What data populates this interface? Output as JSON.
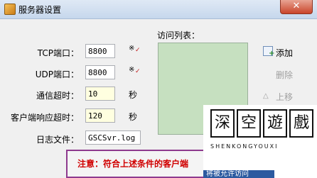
{
  "window": {
    "title": "服务器设置",
    "close_label": "✕"
  },
  "fields": [
    {
      "label": "TCP端口：",
      "value": "8800",
      "icon": "keyboard-icon",
      "icon_text": "※"
    },
    {
      "label": "UDP端口：",
      "value": "8800",
      "icon": "keyboard-icon",
      "icon_text": "※"
    },
    {
      "label": "通信超时：",
      "value": "10",
      "unit": "秒"
    },
    {
      "label": "客户端响应超时：",
      "value": "120",
      "unit": "秒"
    },
    {
      "label": "日志文件：",
      "value": "GSCSvr.log"
    }
  ],
  "access_list": {
    "label": "访问列表："
  },
  "buttons": {
    "add": "添加",
    "delete": "删除",
    "move_up": "上移"
  },
  "notice": "注意：符合上述条件的客户端",
  "watermark": {
    "chars": [
      "深",
      "空",
      "遊",
      "戲"
    ],
    "latin": "SHENKONGYOUXI",
    "bar_text": "将被允许访问"
  },
  "colors": {
    "list_bg": "#c6e0c0",
    "notice_text": "#d00000",
    "notice_border": "#8e3a8e"
  }
}
